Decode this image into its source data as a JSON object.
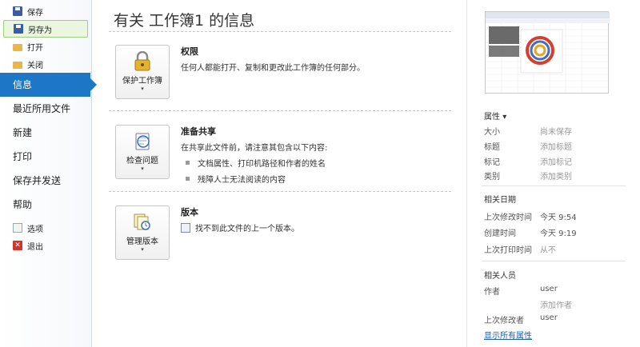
{
  "nav": {
    "small_top": [
      {
        "label": "保存",
        "icon": "save-icon"
      },
      {
        "label": "另存为",
        "icon": "save-as-icon"
      },
      {
        "label": "打开",
        "icon": "open-folder-icon"
      },
      {
        "label": "关闭",
        "icon": "close-folder-icon"
      }
    ],
    "big": [
      {
        "label": "信息"
      },
      {
        "label": "最近所用文件"
      },
      {
        "label": "新建"
      },
      {
        "label": "打印"
      },
      {
        "label": "保存并发送"
      },
      {
        "label": "帮助"
      }
    ],
    "small_bottom": [
      {
        "label": "选项",
        "icon": "options-icon"
      },
      {
        "label": "退出",
        "icon": "exit-icon"
      }
    ]
  },
  "main": {
    "title": "有关 工作簿1 的信息",
    "sections": [
      {
        "button_label": "保护工作簿",
        "title": "权限",
        "description": "任何人都能打开、复制和更改此工作簿的任何部分。"
      },
      {
        "button_label": "检查问题",
        "title": "准备共享",
        "description": "在共享此文件前，请注意其包含以下内容:",
        "bullets": [
          "文档属性、打印机路径和作者的姓名",
          "残障人士无法阅读的内容"
        ]
      },
      {
        "button_label": "管理版本",
        "title": "版本",
        "description": "找不到此文件的上一个版本。"
      }
    ]
  },
  "properties": {
    "header": "属性",
    "rows": [
      {
        "key": "大小",
        "value": "尚未保存"
      },
      {
        "key": "标题",
        "value": "添加标题"
      },
      {
        "key": "标记",
        "value": "添加标记"
      },
      {
        "key": "类别",
        "value": "添加类别"
      }
    ]
  },
  "dates": {
    "header": "相关日期",
    "rows": [
      {
        "key": "上次修改时间",
        "value": "今天 9:54"
      },
      {
        "key": "创建时间",
        "value": "今天 9:19"
      },
      {
        "key": "上次打印时间",
        "value": "从不"
      }
    ]
  },
  "people": {
    "header": "相关人员",
    "author_key": "作者",
    "author_value": "user",
    "add_author": "添加作者",
    "modifier_key": "上次修改者",
    "modifier_value": "user",
    "show_all": "显示所有属性"
  },
  "colors": {
    "accent": "#1e77c6",
    "saveas_border": "#9cce7d",
    "link": "#1e5fb5"
  }
}
